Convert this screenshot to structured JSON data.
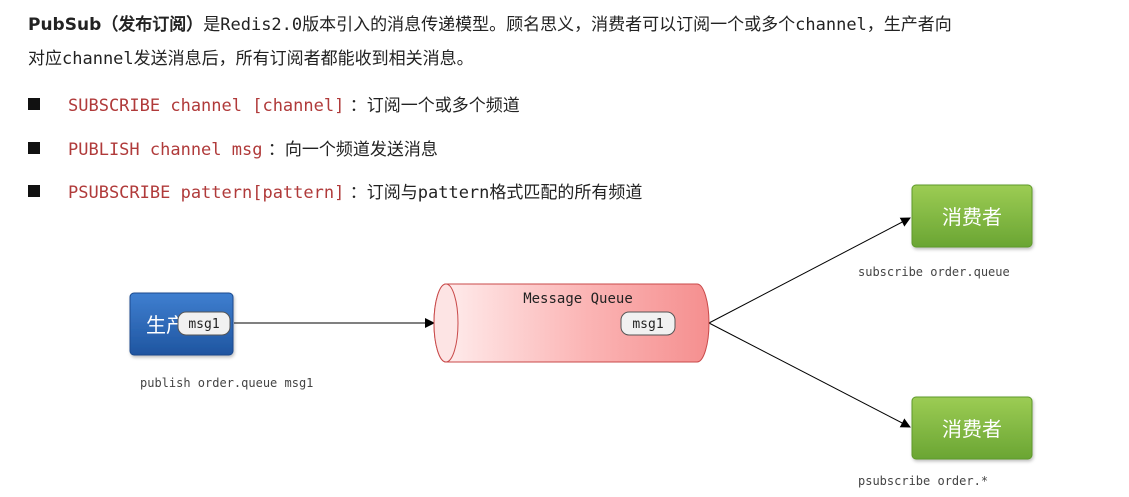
{
  "intro": {
    "term": "PubSub",
    "term_paren": "（发布订阅）",
    "text_a": "是",
    "code_a": "Redis2.0",
    "text_b": "版本引入的消息传递模型。顾名思义，消费者可以订阅一个或多个",
    "code_b": "channel",
    "text_c": "，生产者向",
    "text_d": "对应",
    "code_c": "channel",
    "text_e": "发送消息后，所有订阅者都能收到相关消息。"
  },
  "commands": [
    {
      "code": "SUBSCRIBE channel [channel]",
      "desc": " ：订阅一个或多个频道"
    },
    {
      "code": "PUBLISH channel msg",
      "desc": " ：向一个频道发送消息"
    },
    {
      "code": "PSUBSCRIBE pattern[pattern]",
      "desc": " ：订阅与",
      "desc_code": "pattern",
      "desc_tail": "格式匹配的所有频道"
    }
  ],
  "diagram": {
    "producer_label": "生产",
    "producer_msg": "msg1",
    "producer_caption": "publish order.queue msg1",
    "queue_title": "Message Queue",
    "queue_msg": "msg1",
    "consumer_top_label": "消费者",
    "consumer_top_caption": "subscribe order.queue",
    "consumer_bottom_label": "消费者",
    "consumer_bottom_caption": "psubscribe order.*",
    "colors": {
      "producer": "#2f68b8",
      "consumer": "#7cb342",
      "queue": "#f4a6a6"
    }
  }
}
